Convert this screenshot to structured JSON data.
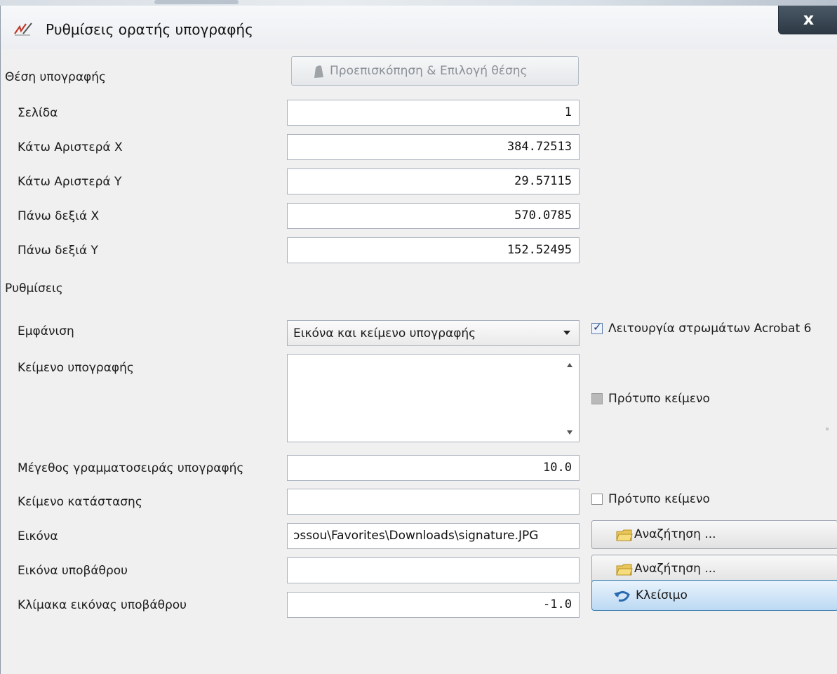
{
  "window": {
    "title": "Ρυθμίσεις ορατής υπογραφής",
    "close_glyph": "x"
  },
  "position": {
    "section_label": "Θέση υπογραφής",
    "preview_button": "Προεπισκόπηση & Επιλογή θέσης",
    "fields": [
      {
        "label": "Σελίδα",
        "value": "1"
      },
      {
        "label": "Κάτω Αριστερά X",
        "value": "384.72513"
      },
      {
        "label": "Κάτω Αριστερά Y",
        "value": "29.57115"
      },
      {
        "label": "Πάνω δεξιά X",
        "value": "570.0785"
      },
      {
        "label": "Πάνω δεξιά Y",
        "value": "152.52495"
      }
    ]
  },
  "settings": {
    "section_label": "Ρυθμίσεις",
    "appearance": {
      "label": "Εμφάνιση",
      "selected": "Εικόνα και κείμενο υπογραφής"
    },
    "acrobat_layers": {
      "label": "Λειτουργία στρωμάτων Acrobat 6",
      "checked": true
    },
    "signature_text": {
      "label": "Κείμενο υπογραφής",
      "value": ""
    },
    "template_text_1": {
      "label": "Πρότυπο κείμενο",
      "checked": false,
      "disabled": true
    },
    "font_size": {
      "label": "Μέγεθος γραμματοσειράς υπογραφής",
      "value": "10.0"
    },
    "status_text": {
      "label": "Κείμενο κατάστασης",
      "value": ""
    },
    "template_text_2": {
      "label": "Πρότυπο κείμενο",
      "checked": false
    },
    "image": {
      "label": "Εικόνα",
      "value": "ɔssou\\Favorites\\Downloads\\signature.JPG"
    },
    "browse_1": "Αναζήτηση ...",
    "background_image": {
      "label": "Εικόνα υποβάθρου",
      "value": ""
    },
    "browse_2": "Αναζήτηση ...",
    "background_scale": {
      "label": "Κλίμακα εικόνας υποβάθρου",
      "value": "-1.0"
    }
  },
  "footer": {
    "close_button": "Κλείσιμο"
  },
  "colors": {
    "dialog_bg": "#f0f0f0",
    "accent_button": "#bcd9f3",
    "close_x_bg": "#2d3944"
  },
  "icons": [
    "signature-pen-icon",
    "preview-page-icon",
    "folder-icon",
    "undo-arrow-icon"
  ]
}
